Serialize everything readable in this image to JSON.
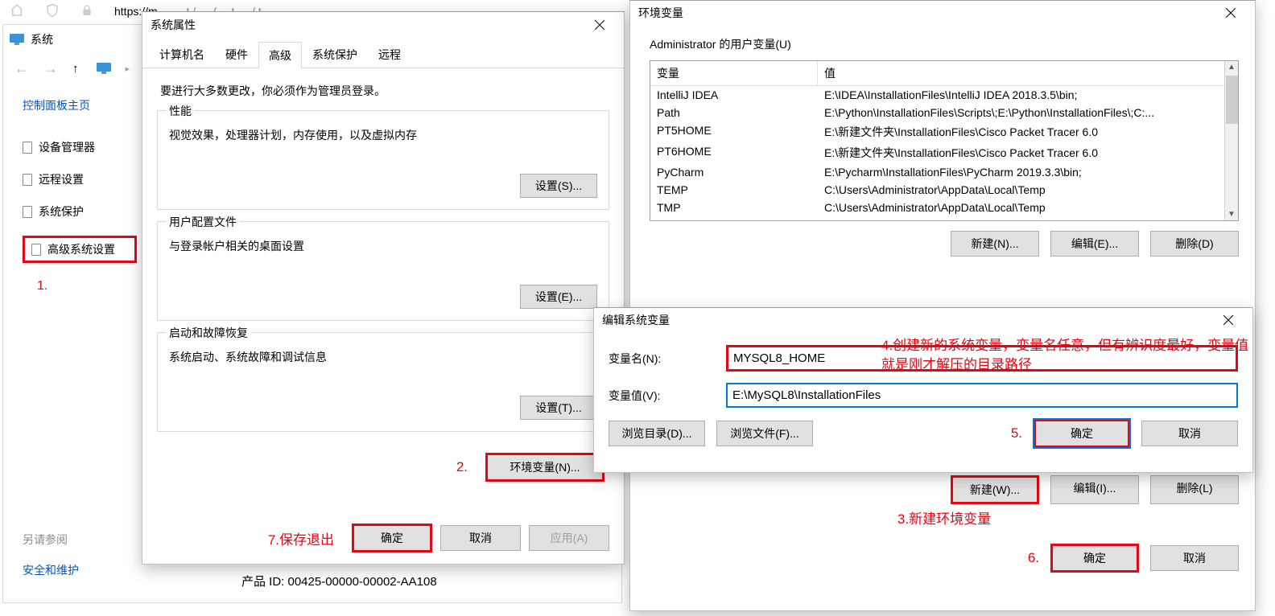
{
  "browser": {
    "url_prefix": "https://m",
    "url_muted": "… … t / … (… t … / t …"
  },
  "system_window": {
    "title": "系统",
    "sidebar": {
      "home": "控制面板主页",
      "items": [
        "设备管理器",
        "远程设置",
        "系统保护",
        "高级系统设置"
      ],
      "step1": "1."
    },
    "see_also": {
      "label": "另请参阅",
      "link": "安全和维护"
    }
  },
  "sysprops": {
    "title": "系统属性",
    "tabs": [
      "计算机名",
      "硬件",
      "高级",
      "系统保护",
      "远程"
    ],
    "active_tab": 2,
    "note": "要进行大多数更改，你必须作为管理员登录。",
    "perf": {
      "legend": "性能",
      "desc": "视觉效果，处理器计划，内存使用，以及虚拟内存",
      "btn": "设置(S)..."
    },
    "profile": {
      "legend": "用户配置文件",
      "desc": "与登录帐户相关的桌面设置",
      "btn": "设置(E)..."
    },
    "startup": {
      "legend": "启动和故障恢复",
      "desc": "系统启动、系统故障和调试信息",
      "btn": "设置(T)..."
    },
    "env_btn": "环境变量(N)...",
    "step2": "2.",
    "footer": {
      "step7": "7.保存退出",
      "ok": "确定",
      "cancel": "取消",
      "apply": "应用(A)"
    }
  },
  "product_id": "产品 ID: 00425-00000-00002-AA108",
  "envdlg": {
    "title": "环境变量",
    "user_section": {
      "label": "Administrator 的用户变量(U)",
      "cols": {
        "var": "变量",
        "val": "值"
      },
      "rows": [
        {
          "var": "IntelliJ IDEA",
          "val": "E:\\IDEA\\InstallationFiles\\IntelliJ IDEA 2018.3.5\\bin;"
        },
        {
          "var": "Path",
          "val": "E:\\Python\\InstallationFiles\\Scripts\\;E:\\Python\\InstallationFiles\\;C:..."
        },
        {
          "var": "PT5HOME",
          "val": "E:\\新建文件夹\\InstallationFiles\\Cisco Packet Tracer 6.0"
        },
        {
          "var": "PT6HOME",
          "val": "E:\\新建文件夹\\InstallationFiles\\Cisco Packet Tracer 6.0"
        },
        {
          "var": "PyCharm",
          "val": "E:\\Pycharm\\InstallationFiles\\PyCharm 2019.3.3\\bin;"
        },
        {
          "var": "TEMP",
          "val": "C:\\Users\\Administrator\\AppData\\Local\\Temp"
        },
        {
          "var": "TMP",
          "val": "C:\\Users\\Administrator\\AppData\\Local\\Temp"
        }
      ],
      "buttons": {
        "new": "新建(N)...",
        "edit": "编辑(E)...",
        "del": "删除(D)"
      }
    },
    "sys_section": {
      "buttons": {
        "new": "新建(W)...",
        "edit": "编辑(I)...",
        "del": "删除(L)"
      }
    },
    "step3": "3.新建环境变量",
    "step6": "6.",
    "footer": {
      "ok": "确定",
      "cancel": "取消"
    }
  },
  "editdlg": {
    "title": "编辑系统变量",
    "name_label": "变量名(N):",
    "name_value": "MYSQL8_HOME",
    "value_label": "变量值(V):",
    "value_value": "E:\\MySQL8\\InstallationFiles",
    "browse_dir": "浏览目录(D)...",
    "browse_file": "浏览文件(F)...",
    "ok": "确定",
    "cancel": "取消",
    "step4": "4.创建新的系统变量，变量名任意，但有辨识度最好，变量值就是刚才解压的目录路径",
    "step5": "5."
  }
}
